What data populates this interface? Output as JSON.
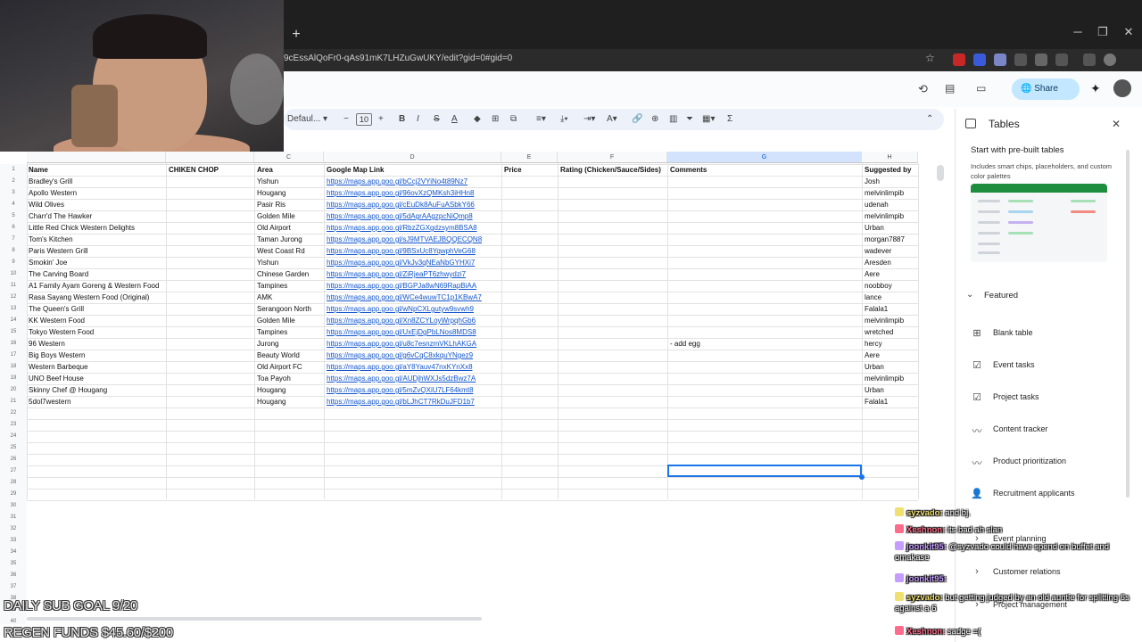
{
  "browser": {
    "new_tab_label": "+",
    "url": "9cEssAlQoFr0-qAs91mK7LHZuGwUKY/edit?gid=0#gid=0",
    "minimize": "─",
    "maximize": "❐",
    "close": "✕"
  },
  "sheets": {
    "share_label": "Share",
    "font_name": "Defaul...",
    "font_size": "10",
    "sigma": "Σ",
    "columns": [
      "C",
      "D",
      "E",
      "F",
      "G",
      "H"
    ],
    "headers": {
      "name": "Name",
      "chicken": "CHIKEN CHOP",
      "area": "Area",
      "link": "Google Map Link",
      "price": "Price",
      "rating": "Rating (Chicken/Sauce/Sides)",
      "comments": "Comments",
      "suggested": "Suggested by"
    },
    "row_numbers": [
      "1",
      "2",
      "3",
      "4",
      "5",
      "6",
      "7",
      "8",
      "9",
      "10",
      "11",
      "12",
      "13",
      "14",
      "15",
      "16",
      "17",
      "18",
      "19",
      "20",
      "21",
      "22",
      "23",
      "24",
      "25",
      "26",
      "27",
      "28",
      "29",
      "30",
      "31",
      "32",
      "33",
      "34",
      "35",
      "36",
      "37",
      "38",
      "39",
      "40"
    ],
    "rows": [
      {
        "name": "Bradley's Grill",
        "area": "Yishun",
        "link": "https://maps.app.goo.gl/bCcj2VYiNo4t89Nz7",
        "comment": "",
        "by": "Josh"
      },
      {
        "name": "Apollo Western",
        "area": "Hougang",
        "link": "https://maps.app.goo.gl/96ovXzQMKsh3iHHn8",
        "comment": "",
        "by": "melvinlimpib"
      },
      {
        "name": "Wild Olives",
        "area": "Pasir Ris",
        "link": "https://maps.app.goo.gl/cEuDk8AuFuASbkY66",
        "comment": "",
        "by": "udenah"
      },
      {
        "name": "Charr'd The Hawker",
        "area": "Golden Mile",
        "link": "https://maps.app.goo.gl/5dAgrAAgzpcNiQmp8",
        "comment": "",
        "by": "melvinlimpib"
      },
      {
        "name": "Little Red Chick Western Delights",
        "area": "Old Airport",
        "link": "https://maps.app.goo.gl/RbzZGXgdzsym8BSA8",
        "comment": "",
        "by": "Urban"
      },
      {
        "name": "Tom's Kitchen",
        "area": "Taman Jurong",
        "link": "https://maps.app.goo.gl/sJ9MTVAEJBQQECQN8",
        "comment": "",
        "by": "morgan7887"
      },
      {
        "name": "Paris Western Grill",
        "area": "West Coast Rd",
        "link": "https://maps.app.goo.gl/9BSxUc8YqwphVeG68",
        "comment": "",
        "by": "wadever"
      },
      {
        "name": "Smokin' Joe",
        "area": "Yishun",
        "link": "https://maps.app.goo.gl/VkJv3qNEaNbGYHXi7",
        "comment": "",
        "by": "Aresden"
      },
      {
        "name": "The Carving Board",
        "area": "Chinese Garden",
        "link": "https://maps.app.goo.gl/ZiRjeaPT6zhwydzi7",
        "comment": "",
        "by": "Aere"
      },
      {
        "name": "A1 Family Ayam Goreng & Western Food",
        "area": "Tampines",
        "link": "https://maps.app.goo.gl/BGPJa8wN69RapBiAA",
        "comment": "",
        "by": "noobboy"
      },
      {
        "name": "Rasa Sayang Western Food (Original)",
        "area": "AMK",
        "link": "https://maps.app.goo.gl/WCe4wuwTC1p1KBwA7",
        "comment": "",
        "by": "lance"
      },
      {
        "name": "The Queen's Grill",
        "area": "Serangoon North",
        "link": "https://maps.app.goo.gl/wNpCXLgutyw9svwh9",
        "comment": "",
        "by": "Falala1"
      },
      {
        "name": "KK Western Food",
        "area": "Golden Mile",
        "link": "https://maps.app.goo.gl/Xn8ZCYLoyWrpqhGb6",
        "comment": "",
        "by": "melvinlimpib"
      },
      {
        "name": "Tokyo Western Food",
        "area": "Tampines",
        "link": "https://maps.app.goo.gl/UxEjDgPbLNos8MDS8",
        "comment": "",
        "by": "wretched"
      },
      {
        "name": "96 Western",
        "area": "Jurong",
        "link": "https://maps.app.goo.gl/u8c7esnzmVKLhAKGA",
        "comment": "- add egg",
        "by": "hercy"
      },
      {
        "name": "Big Boys Western",
        "area": "Beauty World",
        "link": "https://maps.app.goo.gl/g6vCqC8xkquYNgez9",
        "comment": "",
        "by": "Aere"
      },
      {
        "name": "Western Barbeque",
        "area": "Old Airport FC",
        "link": "https://maps.app.goo.gl/aY8Yauv47nxKYnXx8",
        "comment": "",
        "by": "Urban"
      },
      {
        "name": "UNO Beef House",
        "area": "Toa Payoh",
        "link": "https://maps.app.goo.gl/AUDjhWXJs5dzBwz7A",
        "comment": "",
        "by": "melvinlimpib"
      },
      {
        "name": "Skinny Chef @ Hougang",
        "area": "Hougang",
        "link": "https://maps.app.goo.gl/5mZvQXiU7LF64kmt8",
        "comment": "",
        "by": "Urban"
      },
      {
        "name": "5dol7western",
        "area": "Hougang",
        "link": "https://maps.app.goo.gl/bLJhCT7RkDuJFD1b7",
        "comment": "",
        "by": "Falala1"
      }
    ]
  },
  "panel": {
    "title": "Tables",
    "close": "✕",
    "heading": "Start with pre-built tables",
    "subtext": "Includes smart chips, placeholders, and custom color palettes",
    "featured": "Featured",
    "items": [
      {
        "label": "Blank table",
        "icon": "⊞"
      },
      {
        "label": "Event tasks",
        "icon": "☑"
      },
      {
        "label": "Project tasks",
        "icon": "☑"
      },
      {
        "label": "Content tracker",
        "icon": "〰"
      },
      {
        "label": "Product prioritization",
        "icon": "〰"
      },
      {
        "label": "Recruitment applicants",
        "icon": "👤"
      },
      {
        "label": "Event planning",
        "icon": "›"
      },
      {
        "label": "Customer relations",
        "icon": "›"
      },
      {
        "label": "Project management",
        "icon": "›"
      }
    ]
  },
  "overlay": {
    "goal": "DAILY SUB GOAL 9/20",
    "regen": "REGEN FUNDS $45.60/$200",
    "chat": [
      {
        "user": "syzvado:",
        "msg": "and bj.",
        "color": "#f0e070"
      },
      {
        "user": "Xeshnon:",
        "msg": "its bad ah slan",
        "color": "#ff6b8a"
      },
      {
        "user": "joonkit95:",
        "msg": "@syzvado could have spend on buffet and omakase",
        "color": "#c59cff"
      },
      {
        "user": "joonkit95:",
        "msg": "",
        "color": "#c59cff"
      },
      {
        "user": "syzvado:",
        "msg": "but getting judged by an old auntie for splitting 6s against a 6",
        "color": "#f0e070"
      },
      {
        "user": "Xeshnon:",
        "msg": "sadge =(",
        "color": "#ff6b8a"
      }
    ]
  }
}
